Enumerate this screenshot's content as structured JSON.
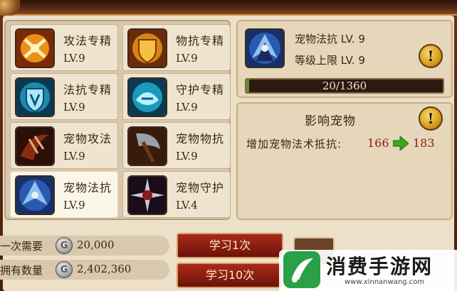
{
  "colors": {
    "accent_red": "#8a1e10",
    "button_red": "#a82a1a",
    "parchment": "#ece0c8"
  },
  "skills": [
    {
      "name": "攻法专精",
      "level": "LV.9",
      "icon": "gold-fireball-icon"
    },
    {
      "name": "物抗专精",
      "level": "LV.9",
      "icon": "gold-shield-icon"
    },
    {
      "name": "法抗专精",
      "level": "LV.9",
      "icon": "blue-shield-icon"
    },
    {
      "name": "守护专精",
      "level": "LV.9",
      "icon": "blue-rune-shield-icon"
    },
    {
      "name": "宠物攻法",
      "level": "LV.9",
      "icon": "red-claw-icon"
    },
    {
      "name": "宠物物抗",
      "level": "LV.9",
      "icon": "axe-warrior-icon"
    },
    {
      "name": "宠物法抗",
      "level": "LV.9",
      "icon": "blue-blade-icon"
    },
    {
      "name": "宠物守护",
      "level": "LV.4",
      "icon": "spiked-star-icon"
    }
  ],
  "selected": {
    "name_line": "宠物法抗  LV. 9",
    "limit_line": "等级上限  LV. 9",
    "progress_text": "20/1360",
    "progress_fraction": 0.0147
  },
  "effect": {
    "title": "影响宠物",
    "label": "增加宠物法术抵抗:",
    "old_value": "166",
    "new_value": "183"
  },
  "cost": {
    "once_label": "一次需要",
    "once_value": "20,000",
    "owned_label": "拥有数量",
    "owned_value": "2,402,360",
    "coin_symbol": "G"
  },
  "buttons": {
    "learn_once": "学习1次",
    "learn_ten": "学习10次"
  },
  "alert_symbol": "!",
  "watermark": {
    "text": "消费手游网",
    "url": "www.xinnanwang.com"
  }
}
